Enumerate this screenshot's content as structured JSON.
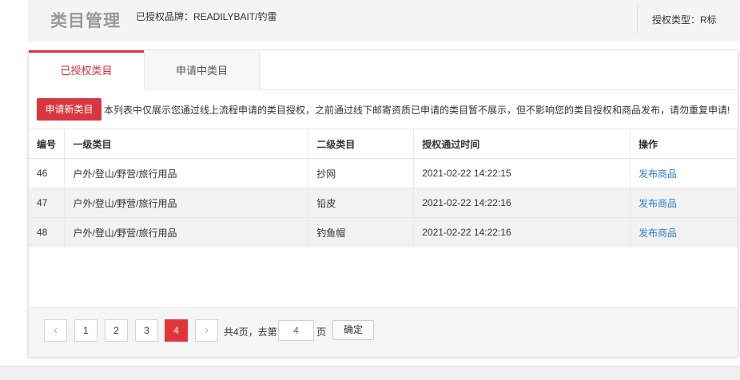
{
  "header": {
    "title": "类目管理",
    "brand": "已授权品牌：READILYBAIT/钓雷",
    "auth_type": "授权类型：R标"
  },
  "tabs": [
    {
      "label": "已授权类目",
      "active": true
    },
    {
      "label": "申请中类目",
      "active": false
    }
  ],
  "notice": {
    "apply_button": "申请新类目",
    "text": "本列表中仅展示您通过线上流程申请的类目授权，之前通过线下邮寄资质已申请的类目暂不展示，但不影响您的类目授权和商品发布，请勿重复申请!"
  },
  "table": {
    "headers": [
      "编号",
      "一级类目",
      "二级类目",
      "授权通过时间",
      "操作"
    ],
    "rows": [
      {
        "id": "46",
        "level1": "户外/登山/野营/旅行用品",
        "level2": "抄网",
        "time": "2021-02-22 14:22:15",
        "action": "发布商品"
      },
      {
        "id": "47",
        "level1": "户外/登山/野营/旅行用品",
        "level2": "铅皮",
        "time": "2021-02-22 14:22:16",
        "action": "发布商品"
      },
      {
        "id": "48",
        "level1": "户外/登山/野营/旅行用品",
        "level2": "钓鱼帽",
        "time": "2021-02-22 14:22:16",
        "action": "发布商品"
      }
    ]
  },
  "pager": {
    "prev": "‹",
    "next": "›",
    "pages": [
      "1",
      "2",
      "3",
      "4"
    ],
    "current": "4",
    "total_text": "共4页，去第",
    "goto_value": "4",
    "page_suffix": "页",
    "confirm": "确定"
  },
  "colors": {
    "accent": "#d9363e",
    "link": "#2d7ec7"
  }
}
